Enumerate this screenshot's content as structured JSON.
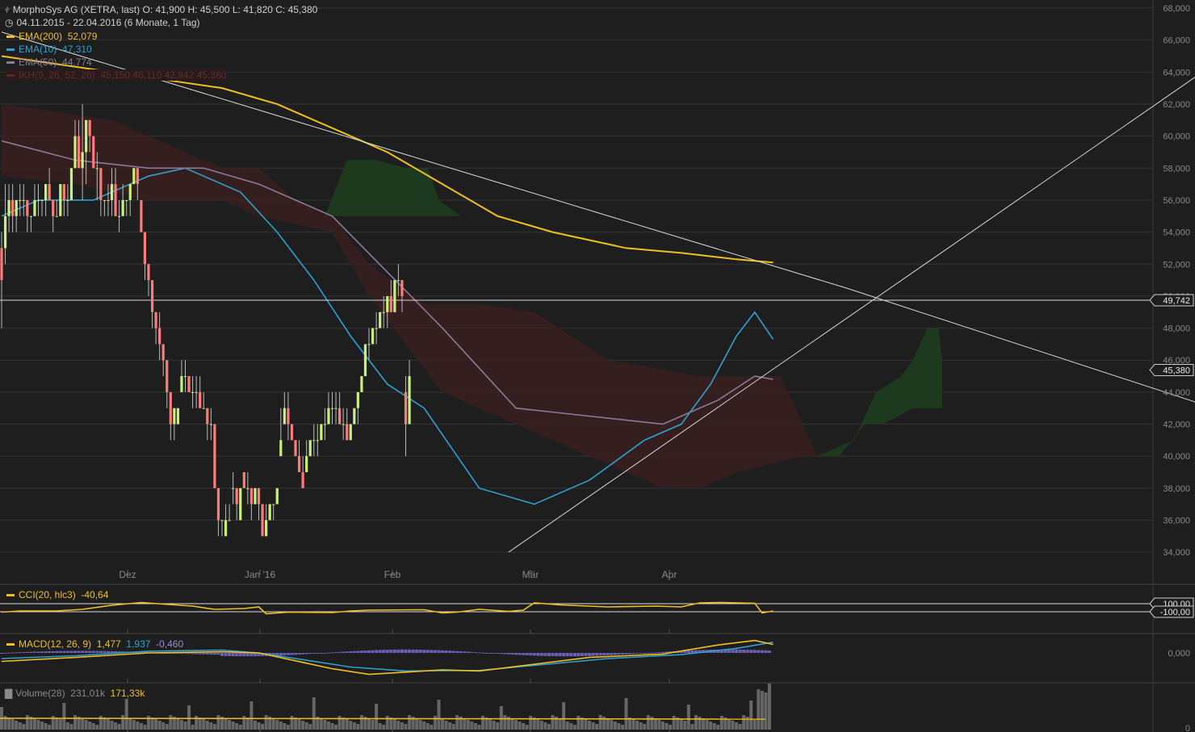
{
  "header": {
    "title_line": "MorphoSys AG (XETRA, last)  O: 41,900  H: 45,500  L: 41,820  C: 45,380",
    "period_line": "04.11.2015 - 22.04.2016 (6 Monate, 1 Tag)"
  },
  "legend": [
    {
      "label": "EMA(200)",
      "value": "52,079",
      "color": "#f0c020"
    },
    {
      "label": "EMA(10)",
      "value": "47,310",
      "color": "#2fa0d0"
    },
    {
      "label": "EMA(50)",
      "value": "44,774",
      "color": "#8a7a9a"
    },
    {
      "label": "IKH(9, 26, 52, 26)",
      "value": "45,150  46,110  42,942  45,380",
      "color": "#5a2a2a"
    }
  ],
  "indicators": {
    "cci": {
      "label": "CCI(20, hlc3)",
      "value": "-40,64",
      "levels": [
        "100,00",
        "-100,00"
      ]
    },
    "macd": {
      "label": "MACD(12, 26, 9)",
      "value": "1,477",
      "signal": "1,937",
      "hist": "-0,460",
      "zero": "0,000"
    },
    "volume": {
      "label": "Volume(28)",
      "value": "231,01k",
      "avg": "171,33k",
      "zero": "0"
    }
  },
  "chart_data": {
    "type": "candlestick",
    "ylim": [
      33,
      68
    ],
    "y_ticks": [
      "34,000",
      "36,000",
      "38,000",
      "40,000",
      "42,000",
      "44,000",
      "46,000",
      "48,000",
      "50,000",
      "52,000",
      "54,000",
      "56,000",
      "58,000",
      "60,000",
      "62,000",
      "64,000",
      "66,000",
      "68,000"
    ],
    "x_ticks": [
      "Dez",
      "Jan '16",
      "Feb",
      "Mär",
      "Apr"
    ],
    "markers": [
      {
        "label": "49,742"
      },
      {
        "label": "45,380"
      }
    ],
    "candles": [
      [
        53,
        54,
        48,
        51
      ],
      [
        53,
        57,
        52,
        55
      ],
      [
        55,
        57,
        54,
        56
      ],
      [
        56,
        57,
        54,
        55
      ],
      [
        55,
        56,
        54,
        56
      ],
      [
        56,
        57,
        55,
        56
      ],
      [
        56,
        57,
        55,
        56
      ],
      [
        56,
        56,
        54,
        55
      ],
      [
        55,
        55,
        54,
        55
      ],
      [
        55,
        57,
        55,
        56
      ],
      [
        56,
        57,
        55,
        56
      ],
      [
        56,
        56,
        55,
        56
      ],
      [
        56,
        57,
        55,
        57
      ],
      [
        57,
        58,
        56,
        56
      ],
      [
        56,
        56,
        54,
        55
      ],
      [
        55,
        56,
        55,
        55
      ],
      [
        55,
        57,
        55,
        57
      ],
      [
        57,
        57,
        55,
        56
      ],
      [
        56,
        57,
        55,
        56
      ],
      [
        56,
        58,
        56,
        58
      ],
      [
        58,
        61,
        58,
        60
      ],
      [
        60,
        61,
        58,
        58
      ],
      [
        58,
        62,
        56,
        59
      ],
      [
        59,
        61,
        57,
        61
      ],
      [
        61,
        61,
        59,
        60
      ],
      [
        60,
        60,
        58,
        58
      ],
      [
        58,
        59,
        56,
        58
      ],
      [
        58,
        58,
        55,
        56
      ],
      [
        56,
        56,
        55,
        56
      ],
      [
        56,
        57,
        55,
        56
      ],
      [
        56,
        58,
        55,
        57
      ],
      [
        57,
        58,
        55,
        55
      ],
      [
        55,
        56,
        54,
        55
      ],
      [
        55,
        57,
        55,
        56
      ],
      [
        56,
        56,
        55,
        56
      ],
      [
        56,
        57,
        55,
        57
      ],
      [
        57,
        58,
        57,
        58
      ],
      [
        58,
        58,
        56,
        57
      ],
      [
        56,
        56,
        54,
        54
      ],
      [
        54,
        54,
        51,
        52
      ],
      [
        52,
        52,
        50,
        51
      ],
      [
        51,
        51,
        48,
        49
      ],
      [
        49,
        49,
        47,
        48
      ],
      [
        48,
        49,
        46,
        47
      ],
      [
        47,
        47,
        45,
        46
      ],
      [
        46,
        46,
        43,
        44
      ],
      [
        44,
        44,
        41,
        42
      ],
      [
        42,
        43,
        41,
        43
      ],
      [
        42,
        43,
        42,
        43
      ],
      [
        44,
        46,
        44,
        45
      ],
      [
        45,
        46,
        44,
        45
      ],
      [
        45,
        45,
        44,
        44
      ],
      [
        44,
        45,
        43,
        44
      ],
      [
        44,
        45,
        43,
        44
      ],
      [
        44,
        45,
        43,
        43
      ],
      [
        43,
        44,
        43,
        43
      ],
      [
        43,
        43,
        41,
        42
      ],
      [
        42,
        43,
        41,
        42
      ],
      [
        42,
        42,
        38,
        38
      ],
      [
        38,
        38,
        35,
        36
      ],
      [
        36,
        36,
        35,
        36
      ],
      [
        35,
        37,
        35,
        36
      ],
      [
        36,
        37,
        36,
        36
      ],
      [
        38,
        39,
        37,
        38
      ],
      [
        38,
        38,
        36,
        37
      ],
      [
        36,
        38,
        36,
        38
      ],
      [
        39,
        39,
        38,
        38
      ],
      [
        38,
        39,
        37,
        38
      ],
      [
        38,
        38,
        36,
        37
      ],
      [
        37,
        38,
        37,
        38
      ],
      [
        38,
        38,
        36,
        37
      ],
      [
        37,
        37,
        35,
        35
      ],
      [
        35,
        37,
        35,
        36
      ],
      [
        36,
        37,
        36,
        37
      ],
      [
        37,
        37,
        36,
        37
      ],
      [
        37,
        38,
        37,
        38
      ],
      [
        40,
        43,
        40,
        41
      ],
      [
        42,
        44,
        42,
        43
      ],
      [
        43,
        44,
        41,
        42
      ],
      [
        42,
        42,
        41,
        41
      ],
      [
        41,
        41,
        40,
        40
      ],
      [
        40,
        41,
        39,
        39
      ],
      [
        39,
        40,
        38,
        38
      ],
      [
        39,
        41,
        39,
        40
      ],
      [
        40,
        41,
        40,
        41
      ],
      [
        41,
        42,
        40,
        41
      ],
      [
        41,
        42,
        40,
        41
      ],
      [
        41,
        42,
        41,
        42
      ],
      [
        42,
        43,
        41,
        42
      ],
      [
        42,
        44,
        42,
        43
      ],
      [
        43,
        44,
        42,
        43
      ],
      [
        43,
        44,
        42,
        43
      ],
      [
        43,
        44,
        42,
        42
      ],
      [
        42,
        43,
        41,
        42
      ],
      [
        42,
        43,
        41,
        41
      ],
      [
        41,
        42,
        41,
        42
      ],
      [
        42,
        43,
        42,
        43
      ],
      [
        43,
        44,
        42,
        44
      ],
      [
        44,
        45,
        44,
        45
      ],
      [
        45,
        47,
        45,
        47
      ],
      [
        47,
        48,
        46,
        47
      ],
      [
        47,
        48,
        47,
        48
      ],
      [
        48,
        49,
        47,
        48
      ],
      [
        48,
        49,
        48,
        49
      ],
      [
        49,
        50,
        48,
        49
      ],
      [
        49,
        50,
        48,
        50
      ],
      [
        50,
        51,
        49,
        49
      ],
      [
        49,
        51,
        49,
        51
      ],
      [
        51,
        52,
        50,
        51
      ],
      [
        51,
        51,
        49,
        50
      ],
      [
        44,
        45,
        40,
        42
      ],
      [
        42,
        46,
        42,
        45
      ]
    ],
    "series": [
      {
        "name": "EMA(200)",
        "values": [
          [
            0,
            65
          ],
          [
            30,
            64
          ],
          [
            60,
            63
          ],
          [
            75,
            62
          ],
          [
            90,
            60.5
          ],
          [
            105,
            59
          ],
          [
            120,
            57
          ],
          [
            135,
            55
          ],
          [
            150,
            54
          ],
          [
            170,
            53
          ],
          [
            185,
            52.7
          ],
          [
            200,
            52.3
          ],
          [
            210,
            52.1
          ]
        ]
      },
      {
        "name": "EMA(10)",
        "values": [
          [
            0,
            55
          ],
          [
            10,
            56
          ],
          [
            25,
            56
          ],
          [
            40,
            57.5
          ],
          [
            50,
            58
          ],
          [
            65,
            56.5
          ],
          [
            75,
            54
          ],
          [
            85,
            51
          ],
          [
            95,
            47.5
          ],
          [
            105,
            44.5
          ],
          [
            115,
            43
          ],
          [
            130,
            38
          ],
          [
            145,
            37
          ],
          [
            160,
            38.5
          ],
          [
            175,
            41
          ],
          [
            185,
            42
          ],
          [
            193,
            44.5
          ],
          [
            200,
            47.5
          ],
          [
            205,
            49
          ],
          [
            210,
            47.3
          ]
        ]
      },
      {
        "name": "EMA(50)",
        "values": [
          [
            0,
            59.7
          ],
          [
            20,
            58.5
          ],
          [
            40,
            58
          ],
          [
            55,
            58
          ],
          [
            70,
            57
          ],
          [
            90,
            55
          ],
          [
            105,
            51.5
          ],
          [
            120,
            48
          ],
          [
            140,
            43
          ],
          [
            160,
            42.5
          ],
          [
            180,
            42
          ],
          [
            195,
            43.5
          ],
          [
            205,
            45
          ],
          [
            210,
            44.8
          ]
        ]
      },
      {
        "name": "Trendlinie 1",
        "values": [
          [
            0,
            66.5
          ],
          [
            230,
            50.5
          ],
          [
            330,
            43
          ]
        ]
      },
      {
        "name": "Trendlinie 2",
        "values": [
          [
            138,
            34
          ],
          [
            330,
            64.5
          ]
        ]
      }
    ]
  },
  "colors": {
    "up": "#c8f07a",
    "down": "#ff7a7a",
    "cloud_red": "#3a1e1e",
    "cloud_green": "#1e3a1e",
    "grid": "#353535",
    "text": "#cfcfcf",
    "muted": "#8a8a8a"
  }
}
